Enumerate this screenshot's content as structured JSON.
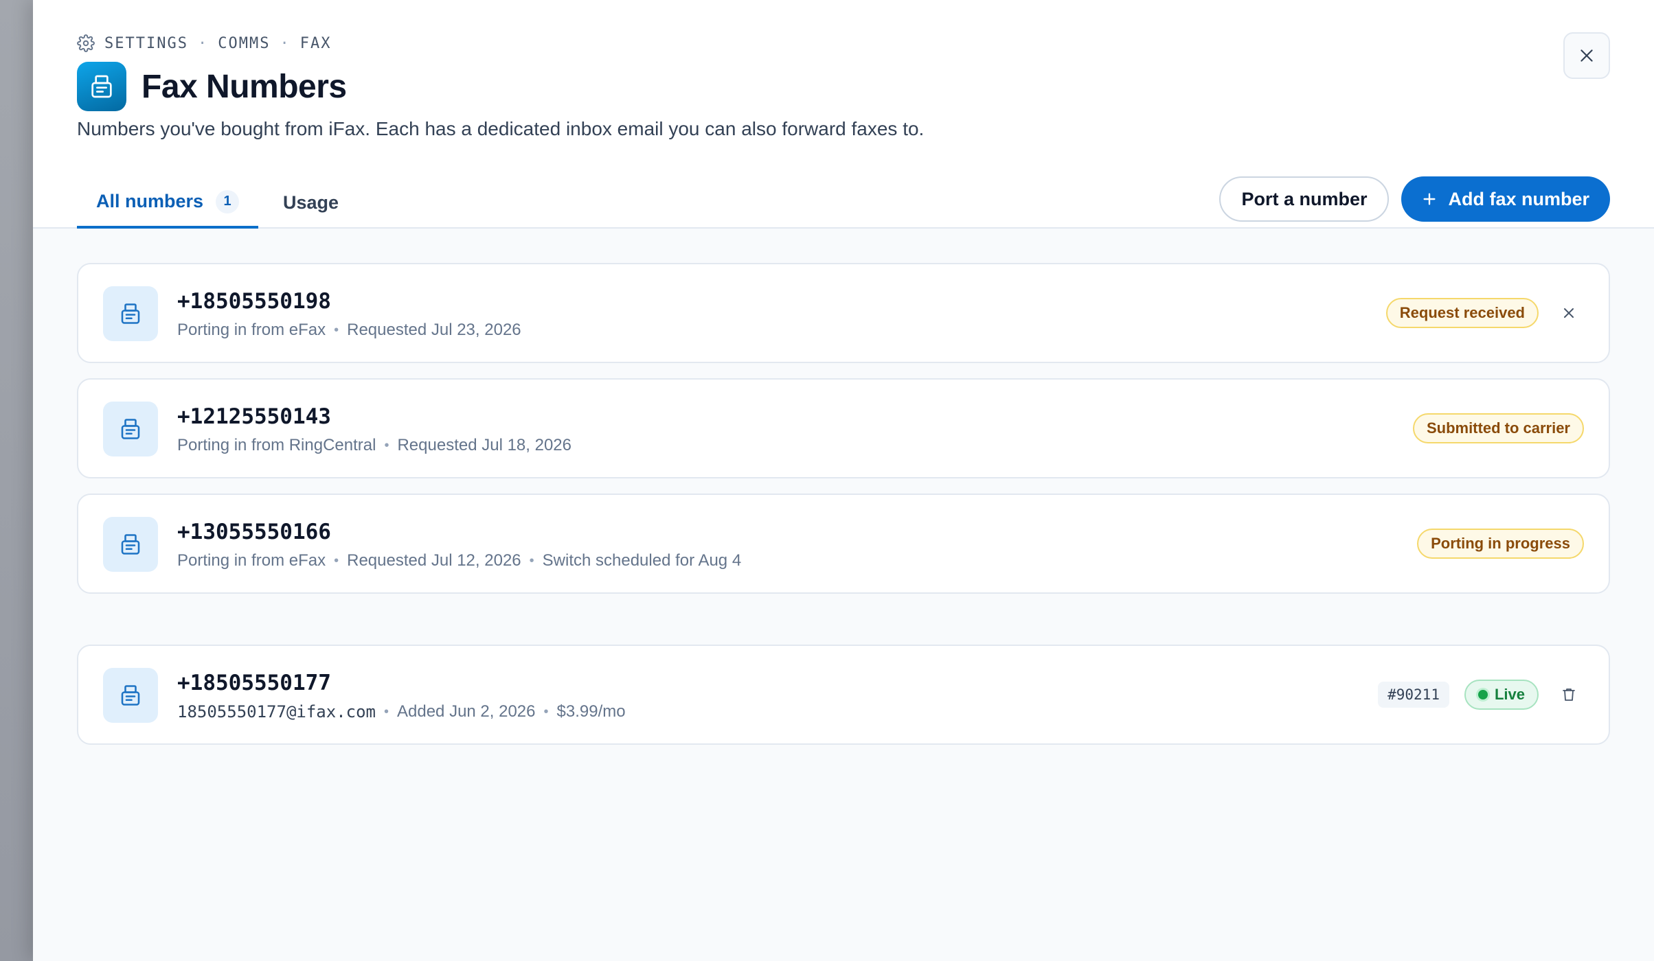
{
  "breadcrumb": {
    "icon": "gear-icon",
    "items": [
      "SETTINGS",
      "COMMS",
      "FAX"
    ],
    "separator": "·"
  },
  "page": {
    "title": "Fax Numbers",
    "icon": "fax-icon",
    "subtitle": "Numbers you've bought from iFax. Each has a dedicated inbox email you can also forward faxes to."
  },
  "tabs": {
    "all_label": "All numbers",
    "all_count": "1",
    "usage_label": "Usage"
  },
  "actions": {
    "port_label": "Port a number",
    "add_label": "Add fax number"
  },
  "porting": [
    {
      "number": "+18505550198",
      "meta": [
        "Porting in from eFax",
        "Requested Jul 23, 2026"
      ],
      "status": "Request received",
      "cancelable": true
    },
    {
      "number": "+12125550143",
      "meta": [
        "Porting in from RingCentral",
        "Requested Jul 18, 2026"
      ],
      "status": "Submitted to carrier",
      "cancelable": false
    },
    {
      "number": "+13055550166",
      "meta": [
        "Porting in from eFax",
        "Requested Jul 12, 2026",
        "Switch scheduled for Aug 4"
      ],
      "status": "Porting in progress",
      "cancelable": false
    }
  ],
  "active": [
    {
      "number": "+18505550177",
      "email": "18505550177@ifax.com",
      "added": "Added Jun 2, 2026",
      "price": "$3.99/mo",
      "id": "#90211",
      "status": "Live"
    }
  ],
  "colors": {
    "accent": "#0b6fd0",
    "amber_text": "#8a4b0a",
    "amber_border": "#f5d86b",
    "live_text": "#15803d"
  }
}
